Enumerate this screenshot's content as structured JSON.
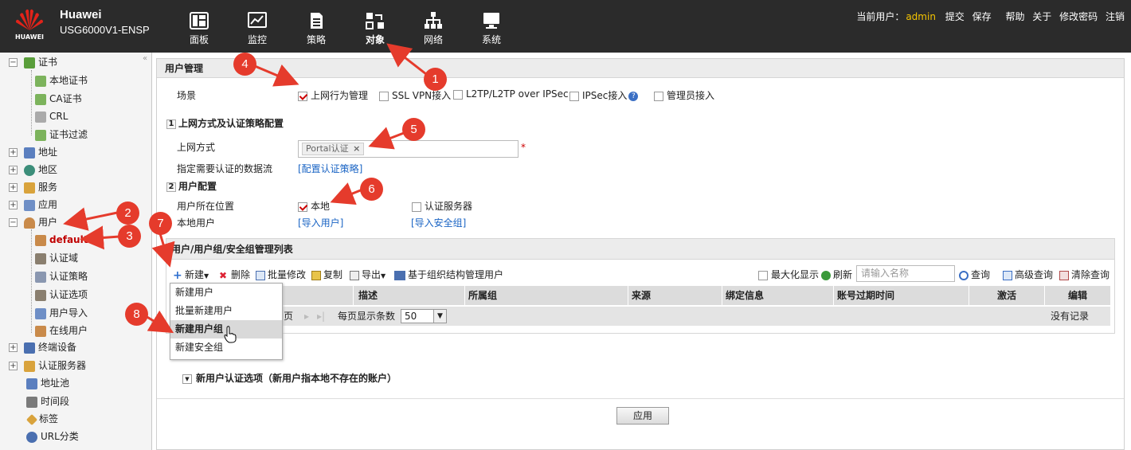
{
  "brand": {
    "name": "Huawei",
    "model": "USG6000V1-ENSP",
    "logo_text": "HUAWEI"
  },
  "nav": [
    {
      "label": "面板",
      "icon": "dashboard-icon"
    },
    {
      "label": "监控",
      "icon": "monitor-icon"
    },
    {
      "label": "策略",
      "icon": "policy-icon"
    },
    {
      "label": "对象",
      "icon": "object-icon"
    },
    {
      "label": "网络",
      "icon": "network-icon"
    },
    {
      "label": "系统",
      "icon": "system-icon"
    }
  ],
  "userbar": {
    "current_user_label": "当前用户：",
    "user": "admin",
    "submit": "提交",
    "save": "保存",
    "help": "帮助",
    "about": "关于",
    "change_password": "修改密码",
    "logout": "注销"
  },
  "sidebar": {
    "items": [
      {
        "label": "证书"
      },
      {
        "label": "本地证书"
      },
      {
        "label": "CA证书"
      },
      {
        "label": "CRL"
      },
      {
        "label": "证书过滤"
      },
      {
        "label": "地址"
      },
      {
        "label": "地区"
      },
      {
        "label": "服务"
      },
      {
        "label": "应用"
      },
      {
        "label": "用户"
      },
      {
        "label": "default"
      },
      {
        "label": "认证域"
      },
      {
        "label": "认证策略"
      },
      {
        "label": "认证选项"
      },
      {
        "label": "用户导入"
      },
      {
        "label": "在线用户"
      },
      {
        "label": "终端设备"
      },
      {
        "label": "认证服务器"
      },
      {
        "label": "地址池"
      },
      {
        "label": "时间段"
      },
      {
        "label": "标签"
      },
      {
        "label": "URL分类"
      }
    ]
  },
  "main": {
    "title": "用户管理",
    "scene_label": "场景",
    "scenes": [
      {
        "label": "上网行为管理",
        "checked": true
      },
      {
        "label": "SSL VPN接入",
        "checked": false
      },
      {
        "label": "L2TP/L2TP over IPSec",
        "checked": false
      },
      {
        "label": "IPSec接入",
        "checked": false
      },
      {
        "label": "管理员接入",
        "checked": false
      }
    ],
    "sec1_num": "1",
    "sec1_title": "上网方式及认证策略配置",
    "access_label": "上网方式",
    "access_tag": "Portal认证",
    "required_mark": "*",
    "flow_label": "指定需要认证的数据流",
    "flow_link": "[配置认证策略]",
    "sec2_num": "2",
    "sec2_title": "用户配置",
    "location_label": "用户所在位置",
    "loc_local": "本地",
    "loc_server": "认证服务器",
    "local_user_label": "本地用户",
    "import_user": "[导入用户]",
    "import_group": "[导入安全组]",
    "list_title": "用户/用户组/安全组管理列表",
    "toolbar": {
      "new": "新建",
      "delete": "删除",
      "batch_edit": "批量修改",
      "copy": "复制",
      "export": "导出",
      "org": "基于组织结构管理用户",
      "maximize": "最大化显示",
      "refresh": "刷新",
      "search_placeholder": "请输入名称",
      "query": "查询",
      "advanced": "高级查询",
      "clear": "清除查询"
    },
    "columns": [
      "描述",
      "所属组",
      "来源",
      "绑定信息",
      "账号过期时间",
      "激活",
      "编辑"
    ],
    "pager": {
      "page_suffix": "页",
      "per_page_label": "每页显示条数",
      "per_page": "50",
      "no_records": "没有记录"
    },
    "dropdown": [
      "新建用户",
      "批量新建用户",
      "新建用户组",
      "新建安全组"
    ],
    "new_user_option": "新用户认证选项（新用户指本地不存在的账户）",
    "apply": "应用"
  },
  "annotations": [
    "1",
    "2",
    "3",
    "4",
    "5",
    "6",
    "7",
    "8"
  ],
  "colors": {
    "header_bg": "#2b2b2b",
    "annotation": "#e53b2c",
    "link": "#1a64c4",
    "selected": "#c00000"
  }
}
